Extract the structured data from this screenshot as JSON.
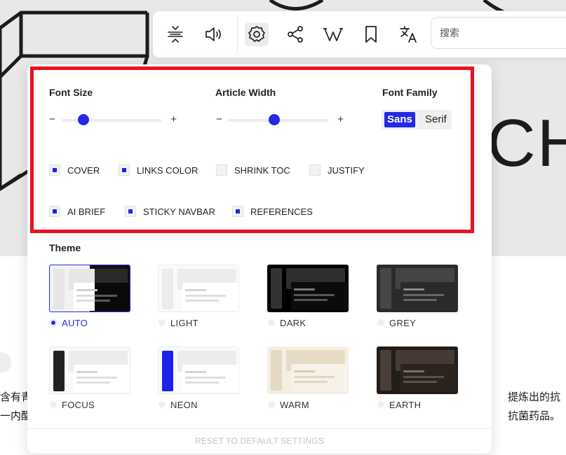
{
  "background": {
    "hero_letters": "CH",
    "article_left": [
      "含有青",
      "一内酯"
    ],
    "article_right": [
      "提炼出的抗",
      "抗菌药品。"
    ]
  },
  "toolbar": {
    "buttons": [
      {
        "name": "toc-button",
        "icon": "toc-icon"
      },
      {
        "name": "read-aloud-button",
        "icon": "speaker-icon"
      },
      {
        "name": "settings-button",
        "icon": "gear-icon",
        "active": true
      },
      {
        "name": "share-button",
        "icon": "share-icon"
      },
      {
        "name": "wikipedia-button",
        "icon": "wikipedia-icon"
      },
      {
        "name": "bookmark-button",
        "icon": "bookmark-icon"
      },
      {
        "name": "translate-button",
        "icon": "translate-icon"
      }
    ],
    "search": {
      "placeholder": "搜索",
      "value": ""
    }
  },
  "settings": {
    "font_size": {
      "label": "Font Size",
      "minus": "−",
      "plus": "+",
      "level": 0.22
    },
    "article_width": {
      "label": "Article Width",
      "minus": "−",
      "plus": "+",
      "level": 0.46
    },
    "font_family": {
      "label": "Font Family",
      "options": [
        "Sans",
        "Serif"
      ],
      "selected": "Sans"
    },
    "checkboxes": [
      {
        "label": "COVER",
        "checked": true
      },
      {
        "label": "LINKS COLOR",
        "checked": true
      },
      {
        "label": "SHRINK TOC",
        "checked": false
      },
      {
        "label": "JUSTIFY",
        "checked": false
      },
      {
        "label": "AI BRIEF",
        "checked": true
      },
      {
        "label": "STICKY NAVBAR",
        "checked": true
      },
      {
        "label": "REFERENCES",
        "checked": true
      }
    ],
    "theme": {
      "label": "Theme",
      "selected": "AUTO",
      "options": [
        "AUTO",
        "LIGHT",
        "DARK",
        "GREY",
        "FOCUS",
        "NEON",
        "WARM",
        "EARTH"
      ]
    },
    "reset_label": "RESET TO DEFAULT SETTINGS"
  },
  "colors": {
    "accent": "#2329e6",
    "highlight": "#e8141c"
  }
}
